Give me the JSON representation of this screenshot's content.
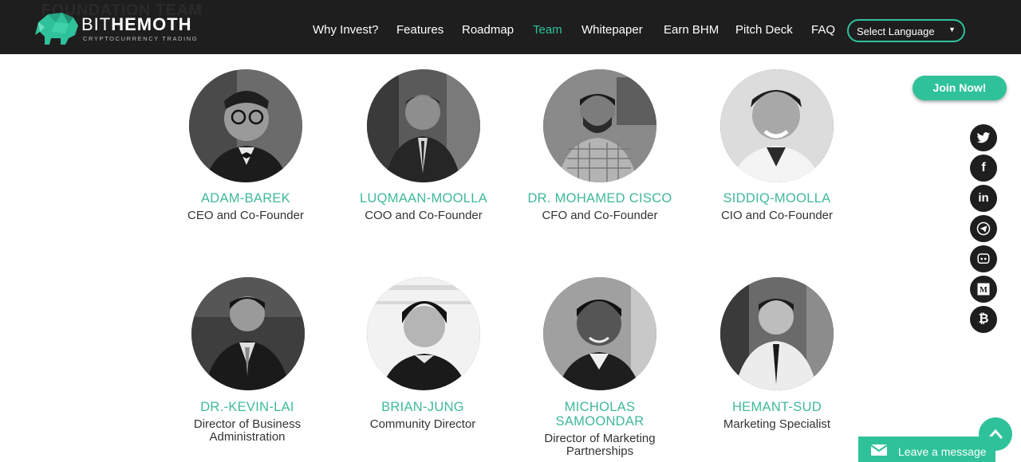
{
  "header": {
    "section_title": "FOUNDATION TEAM",
    "logo": {
      "word_light": "BIT",
      "word_bold": "HEMOTH",
      "tagline": "CRYPTOCURRENCY TRADING"
    },
    "nav": [
      {
        "label": "Why Invest?"
      },
      {
        "label": "Features"
      },
      {
        "label": "Roadmap"
      },
      {
        "label": "Team",
        "active": true
      },
      {
        "label": "Whitepaper"
      },
      {
        "label": "Earn BHM"
      },
      {
        "label": "Pitch Deck"
      },
      {
        "label": "FAQ"
      }
    ],
    "language_select": {
      "value": "Select Language",
      "caret": "▼"
    }
  },
  "team": [
    {
      "name": "ADAM-BAREK",
      "role": "CEO and Co-Founder"
    },
    {
      "name": "LUQMAAN-MOOLLA",
      "role": "COO and Co-Founder"
    },
    {
      "name": "DR. MOHAMED CISCO",
      "role": "CFO and Co-Founder"
    },
    {
      "name": "SIDDIQ-MOOLLA",
      "role": "CIO and Co-Founder"
    },
    {
      "name": "DR.-KEVIN-LAI",
      "role_line1": "Director of Business",
      "role_line2": "Administration"
    },
    {
      "name": "BRIAN-JUNG",
      "role": "Community Director"
    },
    {
      "name_line1": "MICHOLAS",
      "name_line2": "SAMOONDAR",
      "role_line1": "Director of Marketing",
      "role_line2": "Partnerships"
    },
    {
      "name": "HEMANT-SUD",
      "role": "Marketing Specialist"
    }
  ],
  "widgets": {
    "join_label": "Join Now!",
    "social_icons": [
      "twitter-icon",
      "facebook-icon",
      "linkedin-icon",
      "telegram-icon",
      "discord-icon",
      "medium-icon",
      "bitcoin-icon"
    ],
    "social_glyphs": {
      "facebook": "f",
      "linkedin": "in",
      "medium": "M",
      "bitcoin": "₿"
    },
    "leave_message_label": "Leave a message"
  },
  "colors": {
    "accent": "#2fc29a",
    "header_bg": "#1e1e1e",
    "name_color": "#3fb99a"
  }
}
